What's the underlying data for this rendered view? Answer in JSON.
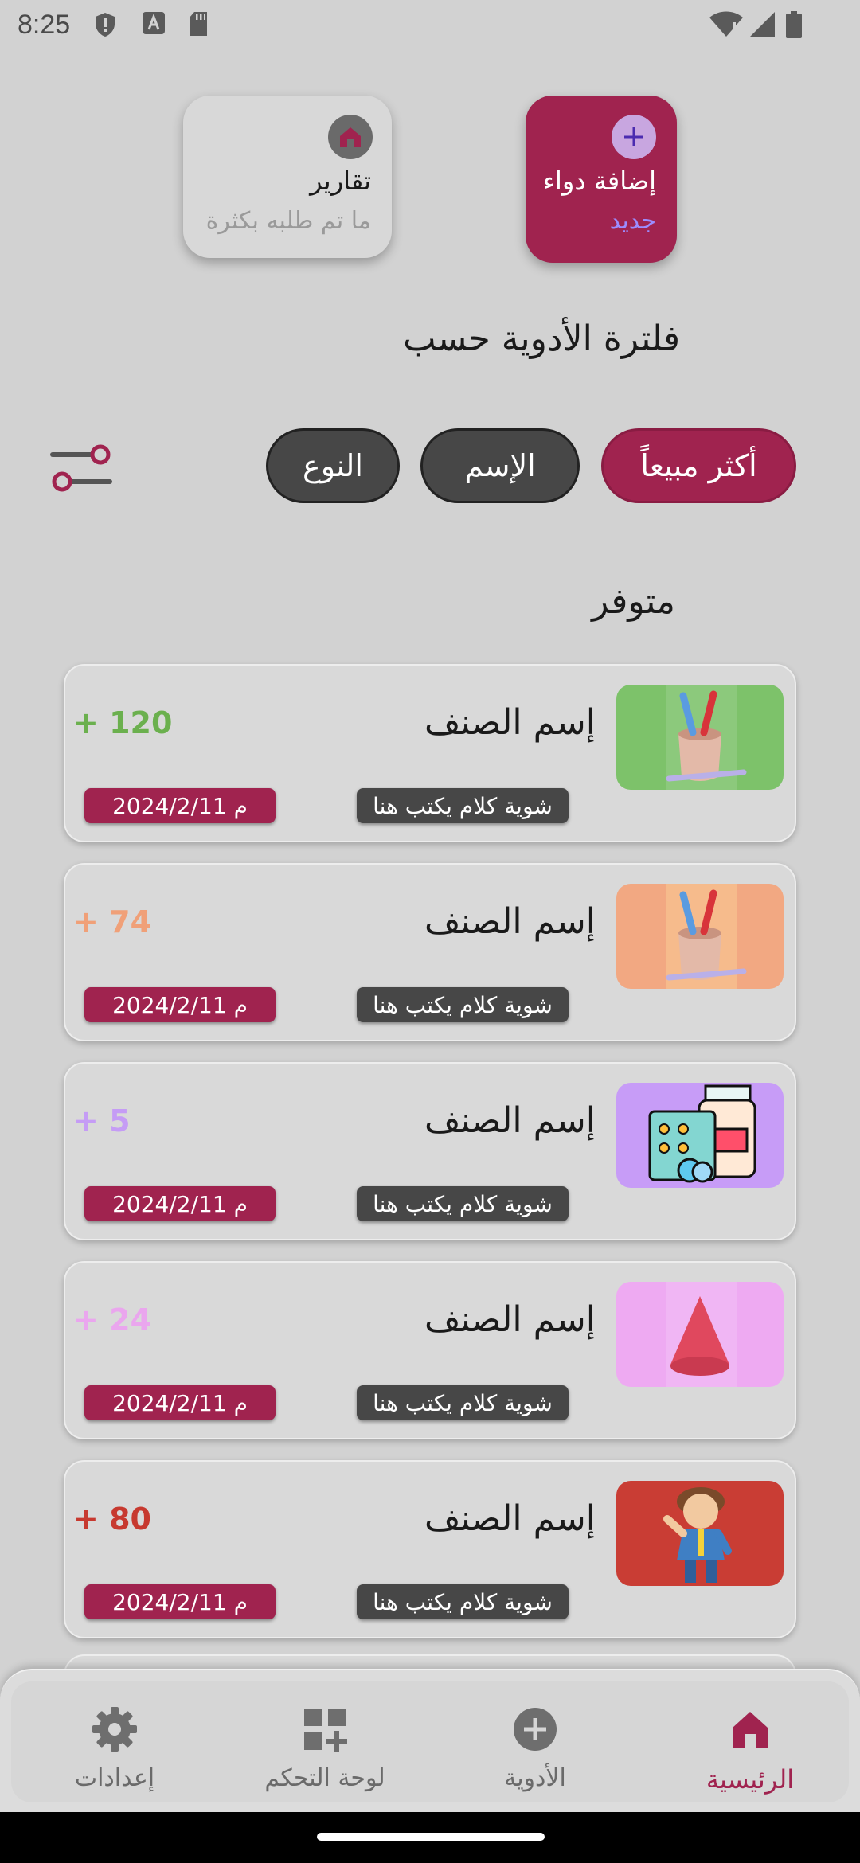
{
  "status_bar": {
    "time": "8:25"
  },
  "quick_cards": {
    "add": {
      "icon": "plus-icon",
      "title": "إضافة دواء",
      "subtitle": "جديد"
    },
    "reports": {
      "icon": "home-icon",
      "title": "تقارير",
      "subtitle": "ما تم طلبه بكثرة"
    }
  },
  "filter": {
    "title": "فلترة الأدوية حسب",
    "chips": [
      "أكثر مبيعاً",
      "الإسم",
      "النوع"
    ]
  },
  "section_title": "متوفر",
  "items": [
    {
      "name": "إسم الصنف",
      "qty": "120",
      "qty_color": "#6bb04e",
      "desc": "شوية كلام يكتب هنا",
      "date": "2024/2/11 م",
      "thumb_bg": "#7dc26a"
    },
    {
      "name": "إسم الصنف",
      "qty": "74",
      "qty_color": "#f0a078",
      "desc": "شوية كلام يكتب هنا",
      "date": "2024/2/11 م",
      "thumb_bg": "#f2a882"
    },
    {
      "name": "إسم الصنف",
      "qty": "5",
      "qty_color": "#c59cf5",
      "desc": "شوية كلام يكتب هنا",
      "date": "2024/2/11 م",
      "thumb_bg": "#c79cf7"
    },
    {
      "name": "إسم الصنف",
      "qty": "24",
      "qty_color": "#eaa6ee",
      "desc": "شوية كلام يكتب هنا",
      "date": "2024/2/11 م",
      "thumb_bg": "#eeaaf2"
    },
    {
      "name": "إسم الصنف",
      "qty": "80",
      "qty_color": "#c7392f",
      "desc": "شوية كلام يكتب هنا",
      "date": "2024/2/11 م",
      "thumb_bg": "#c93d34"
    }
  ],
  "bottom_nav": [
    {
      "label": "الرئيسية",
      "icon": "home-icon",
      "active": true
    },
    {
      "label": "الأدوية",
      "icon": "add-circle-icon",
      "active": false
    },
    {
      "label": "لوحة التحكم",
      "icon": "dashboard-add-icon",
      "active": false
    },
    {
      "label": "إعدادات",
      "icon": "gear-icon",
      "active": false
    }
  ],
  "colors": {
    "accent": "#a0234f",
    "chip_dark": "#474747",
    "background": "#d2d2d2"
  }
}
